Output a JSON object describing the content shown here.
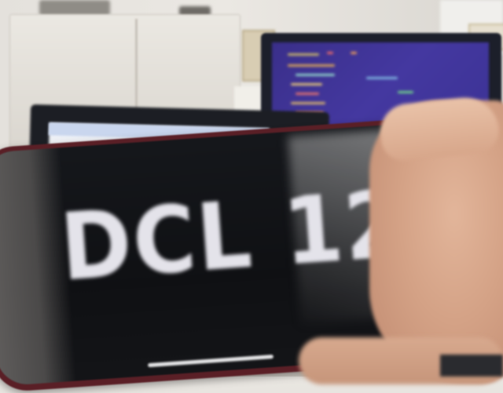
{
  "scene": {
    "subject": "phone-display",
    "phone_display_text": "DCL 12",
    "colors": {
      "phone_case": "#5a1f26",
      "phone_screen": "#15171b",
      "display_text": "#e4e3ea",
      "monitor_screen": "#4438a0",
      "laptop_screen": "#e7ebf1",
      "skin": "#d4a286",
      "wall": "#e9e6e1"
    }
  }
}
